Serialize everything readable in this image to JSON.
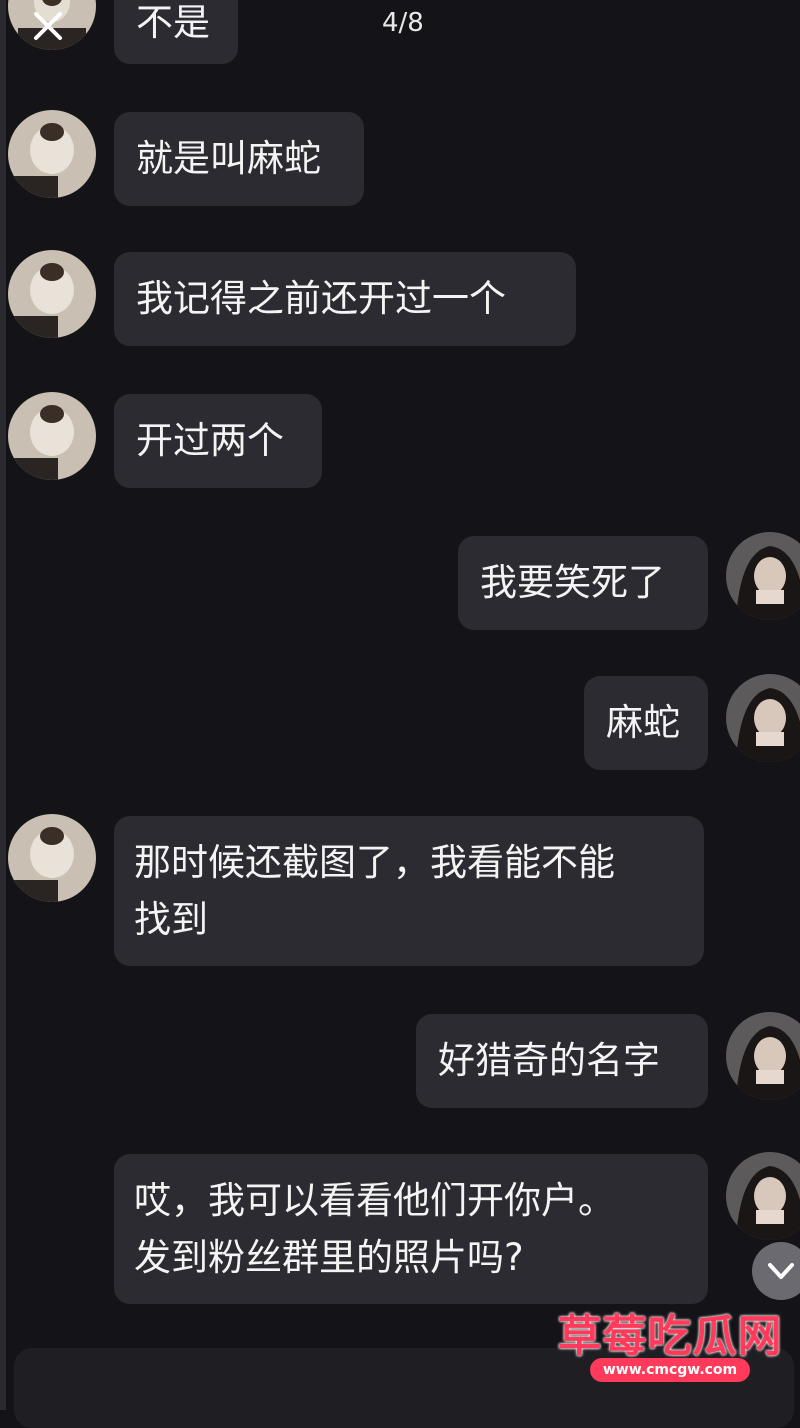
{
  "viewer": {
    "page_counter": "4/8",
    "close_icon": "close-icon",
    "scroll_down_icon": "chevron-down-icon"
  },
  "messages": [
    {
      "side": "left",
      "text": "不是"
    },
    {
      "side": "left",
      "text": "就是叫麻蛇"
    },
    {
      "side": "left",
      "text": "我记得之前还开过一个"
    },
    {
      "side": "left",
      "text": "开过两个"
    },
    {
      "side": "right",
      "text": "我要笑死了"
    },
    {
      "side": "right",
      "text": "麻蛇"
    },
    {
      "side": "left",
      "lines": [
        "那时候还截图了，我看能不能",
        "找到"
      ]
    },
    {
      "side": "right",
      "text": "好猎奇的名字"
    },
    {
      "side": "right",
      "lines": [
        "哎，我可以看看他们开你户。",
        "发到粉丝群里的照片吗?"
      ]
    }
  ],
  "watermark": {
    "title": "草莓吃瓜网",
    "url": "www.cmcgw.com",
    "color": "#ff3a5a"
  },
  "colors": {
    "background": "#141418",
    "bubble": "#2b2b31",
    "text": "#f4f4f4"
  }
}
